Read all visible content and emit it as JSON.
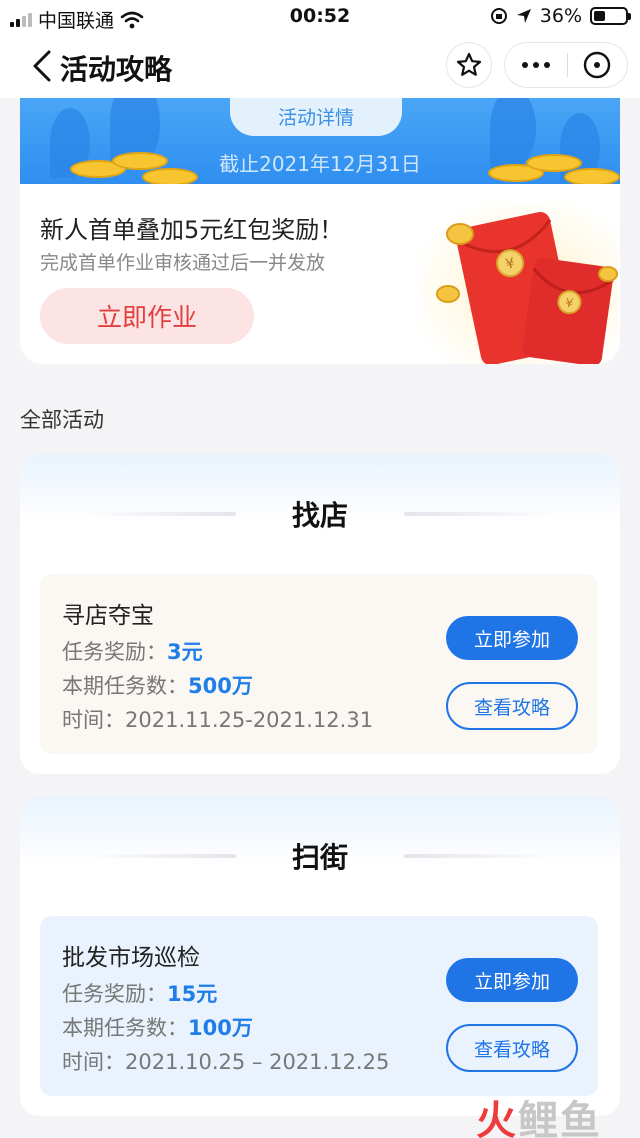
{
  "status_bar": {
    "carrier": "中国联通",
    "time": "00:52",
    "battery_percent": "36%",
    "battery_level": 0.36
  },
  "nav": {
    "title": "活动攻略",
    "icons": [
      "back-chevron-icon",
      "star-icon",
      "more-icon",
      "close-icon"
    ]
  },
  "banner": {
    "detail_button": "活动详情",
    "deadline": "截止2021年12月31日",
    "colors": {
      "bg": "#3a97f2",
      "pill": "#e3f1fd"
    }
  },
  "promo": {
    "title": "新人首单叠加5元红包奖励！",
    "subtitle": "完成首单作业审核通过后一并发放",
    "cta": "立即作业",
    "colors": {
      "cta_bg": "#fde4e4",
      "cta_text": "#e23e3e"
    }
  },
  "section_label": "全部活动",
  "activities": [
    {
      "header": "找店",
      "task": {
        "name": "寻店夺宝",
        "reward_label": "任务奖励：",
        "reward_value": "3元",
        "count_label": "本期任务数：",
        "count_value": "500万",
        "time_label": "时间：",
        "time_value": "2021.11.25-2021.12.31",
        "join": "立即参加",
        "guide": "查看攻略"
      }
    },
    {
      "header": "扫街",
      "task": {
        "name": "批发市场巡检",
        "reward_label": "任务奖励：",
        "reward_value": "15元",
        "count_label": "本期任务数：",
        "count_value": "100万",
        "time_label": "时间：",
        "time_value": "2021.10.25 – 2021.12.25",
        "join": "立即参加",
        "guide": "查看攻略"
      }
    }
  ],
  "watermark": {
    "part1": "火",
    "part2": "鲤鱼"
  },
  "accent_color": "#1f74e6"
}
